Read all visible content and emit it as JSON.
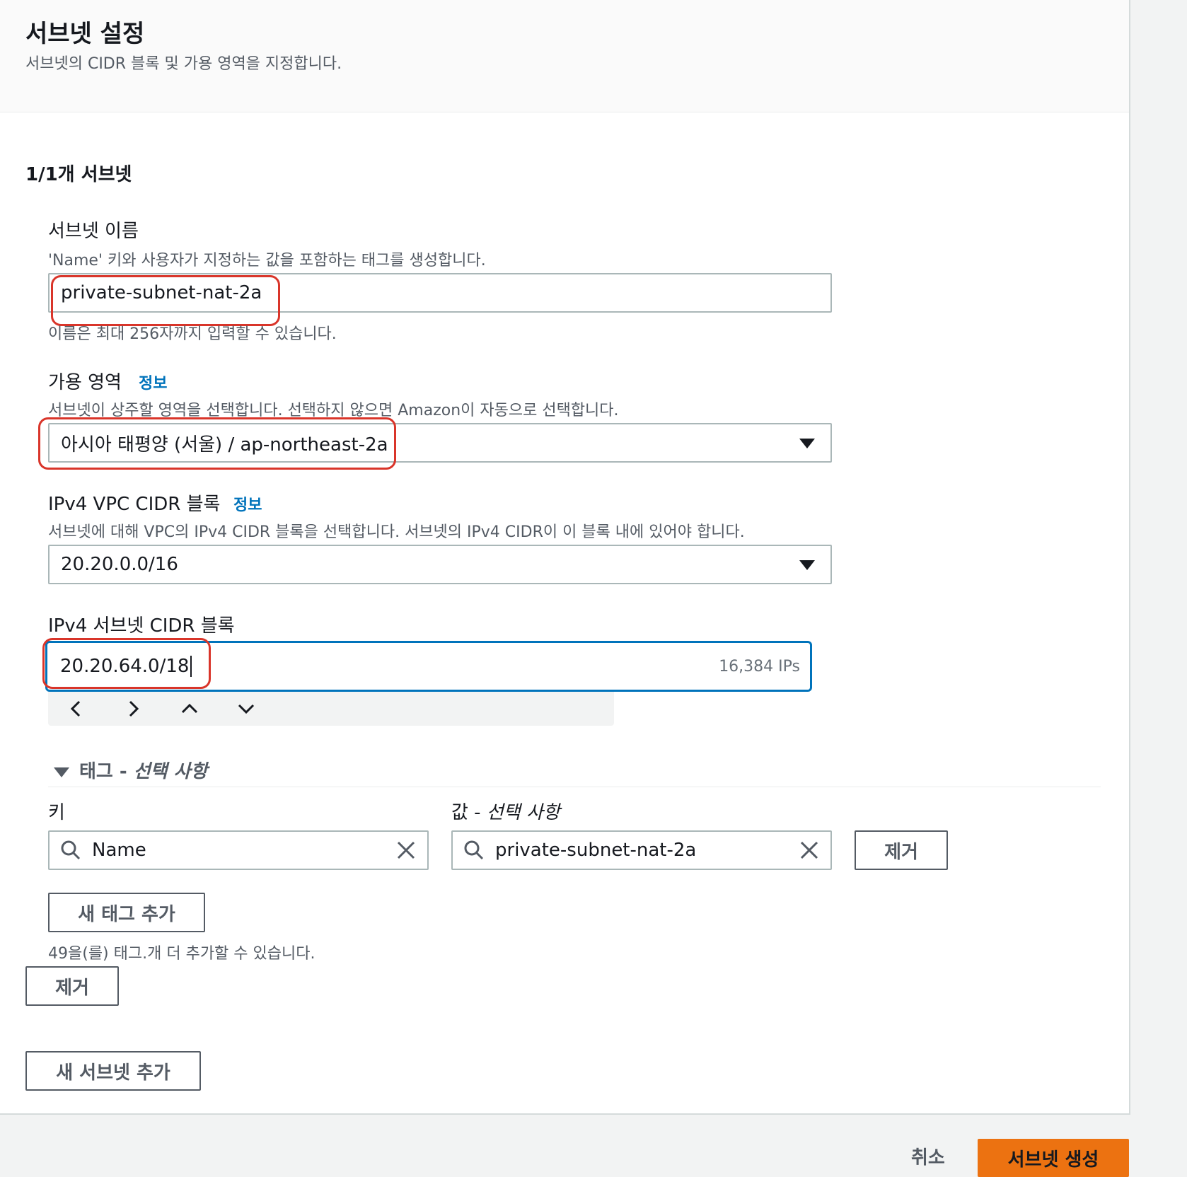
{
  "header": {
    "title": "서브넷 설정",
    "subtitle": "서브넷의 CIDR 블록 및 가용 영역을 지정합니다."
  },
  "subnet_count": "1/1개 서브넷",
  "subnet_name": {
    "label": "서브넷 이름",
    "description": "'Name' 키와 사용자가 지정하는 값을 포함하는 태그를 생성합니다.",
    "value": "private-subnet-nat-2a",
    "hint": "이름은 최대 256자까지 입력할 수 있습니다."
  },
  "availability_zone": {
    "label": "가용 영역",
    "info": "정보",
    "description": "서브넷이 상주할 영역을 선택합니다. 선택하지 않으면 Amazon이 자동으로 선택합니다.",
    "value": "아시아 태평양 (서울) / ap-northeast-2a"
  },
  "vpc_cidr": {
    "label": "IPv4 VPC CIDR 블록",
    "info": "정보",
    "description": "서브넷에 대해 VPC의 IPv4 CIDR 블록을 선택합니다. 서브넷의 IPv4 CIDR이 이 블록 내에 있어야 합니다.",
    "value": "20.20.0.0/16"
  },
  "subnet_cidr": {
    "label": "IPv4 서브넷 CIDR 블록",
    "value": "20.20.64.0/18",
    "ip_count": "16,384 IPs"
  },
  "tags": {
    "section_title": "태그 - ",
    "section_optional": "선택 사항",
    "key_label": "키",
    "value_label_main": "값 - ",
    "value_label_optional": "선택 사항",
    "key_value": "Name",
    "value_value": "private-subnet-nat-2a",
    "remove_label": "제거",
    "add_tag_label": "새 태그 추가",
    "remaining_hint": "49을(를) 태그.개 더 추가할 수 있습니다."
  },
  "remove_subnet_label": "제거",
  "add_subnet_label": "새 서브넷 추가",
  "footer": {
    "cancel_label": "취소",
    "create_label": "서브넷 생성"
  },
  "colors": {
    "primary": "#ec7211",
    "link": "#0073bb",
    "highlight": "#d9352a"
  }
}
